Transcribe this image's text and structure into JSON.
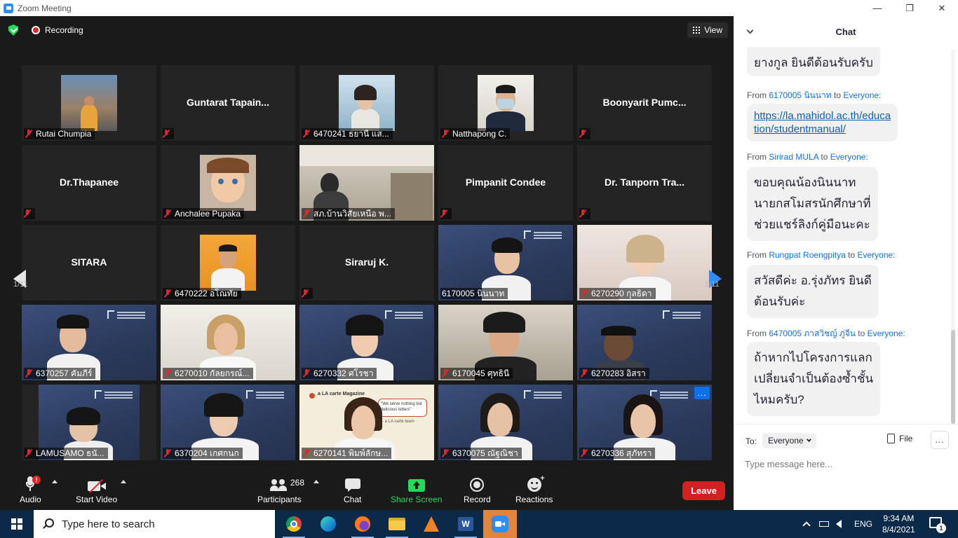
{
  "window": {
    "title": "Zoom Meeting",
    "minimize": "—",
    "restore": "❐",
    "close": "✕"
  },
  "topbar": {
    "recording_label": "Recording",
    "view_label": "View"
  },
  "tiles": [
    {
      "name": "Rutai Chumpia",
      "type": "video",
      "video": "street"
    },
    {
      "name": "Guntarat  Tapain...",
      "type": "name_only",
      "label": ""
    },
    {
      "name": "6470241 ธยานี แส...",
      "type": "video",
      "video": "sky"
    },
    {
      "name": "Natthapong C.",
      "type": "video",
      "video": "mask"
    },
    {
      "name": "Boonyarit  Pumc...",
      "type": "name_only",
      "label": ""
    },
    {
      "name": "Dr.Thapanee",
      "type": "name_only",
      "label": ""
    },
    {
      "name": "Anchalee Pupaka",
      "type": "video",
      "video": "cartoon"
    },
    {
      "name": "สภ.บ้านวิสัยเหนือ พ...",
      "type": "video",
      "video": "room"
    },
    {
      "name": "Pimpanit Condee",
      "type": "name_only",
      "label": ""
    },
    {
      "name": "Dr. Tanporn Tra...",
      "type": "name_only",
      "label": ""
    },
    {
      "name": "SITARA",
      "type": "name_only",
      "label": ""
    },
    {
      "name": "6470222 อโณทัย",
      "type": "video",
      "video": "orange"
    },
    {
      "name": "Siraruj K.",
      "type": "name_only",
      "label": ""
    },
    {
      "name": "6170005 นินนาท",
      "type": "video",
      "video": "blue",
      "active": true
    },
    {
      "name": "6270290 กุลธิดา",
      "type": "video",
      "video": "pink"
    },
    {
      "name": "6370257 คัมภีร์",
      "type": "video",
      "video": "blue"
    },
    {
      "name": "6270010 กัลยกรณ์...",
      "type": "video",
      "video": "light"
    },
    {
      "name": "6270332 ศโรชา",
      "type": "video",
      "video": "blue"
    },
    {
      "name": "6170045 ศุทธินี",
      "type": "video",
      "video": "room2"
    },
    {
      "name": "6270283 อิสรา",
      "type": "video",
      "video": "blue"
    },
    {
      "name": "LAMUSAMO ธนั...",
      "type": "video",
      "video": "blue_small"
    },
    {
      "name": "6370204 เกศกนก",
      "type": "video",
      "video": "blue"
    },
    {
      "name": "6270141 พิมพ์ลักษ...",
      "type": "video",
      "video": "magazine"
    },
    {
      "name": "6370075 ณัฐณิชา",
      "type": "video",
      "video": "blue"
    },
    {
      "name": "6270336 สุภัทรา",
      "type": "video",
      "video": "blue",
      "more": "..."
    }
  ],
  "magazine": {
    "title": "a LA carte Magazine",
    "quote": "\"We serve nothing but delicious letters\"",
    "sign": "- a LA carte team"
  },
  "pagination": {
    "left": "1/11",
    "right": "1/11"
  },
  "toolbar": {
    "audio": "Audio",
    "audio_badge": "!",
    "start_video": "Start Video",
    "participants": "Participants",
    "participants_count": "268",
    "chat": "Chat",
    "share_screen": "Share Screen",
    "record": "Record",
    "reactions": "Reactions",
    "leave": "Leave"
  },
  "chat": {
    "title": "Chat",
    "messages": [
      {
        "from": "",
        "to": "",
        "text": "ยางกูล ยินดีต้อนรับครับ"
      },
      {
        "from": "6170005 นินนาท",
        "to": "Everyone:",
        "text": "https://la.mahidol.ac.th/education/studentmanual/",
        "link_line1": "https://la.mahidol.ac.th/educa",
        "link_line2": "tion/studentmanual/"
      },
      {
        "from": "Sirirad MULA",
        "to": "Everyone:",
        "line1": "ขอบคุณน้องนินนาท",
        "line2": "นายกสโมสรนักศึกษาที่",
        "line3": "ช่วยแชร์ลิงก์คู่มือนะคะ"
      },
      {
        "from": "Rungpat Roengpitya",
        "to": "Everyone:",
        "line1": "สวัสดีค่ะ อ.รุ่งภัทร ยินดี",
        "line2": "ต้อนรับค่ะ"
      },
      {
        "from": "6470005 ภาสวิชญ์ ภู่จีน",
        "to": "Everyone:",
        "line1": "ถ้าหากไปโครงการแลก",
        "line2": "เปลี่ยนจำเป็นต้องซ้ำชั้น",
        "line3": "ไหมครับ?"
      }
    ],
    "from_prefix": "From",
    "to_word": "to",
    "to_label": "To:",
    "recipient": "Everyone",
    "file_label": "File",
    "more": "...",
    "input_placeholder": "Type message here..."
  },
  "taskbar": {
    "search_placeholder": "Type here to search",
    "word_letter": "W",
    "language": "ENG",
    "time": "9:34 AM",
    "date": "8/4/2021",
    "notification_count": "1"
  }
}
